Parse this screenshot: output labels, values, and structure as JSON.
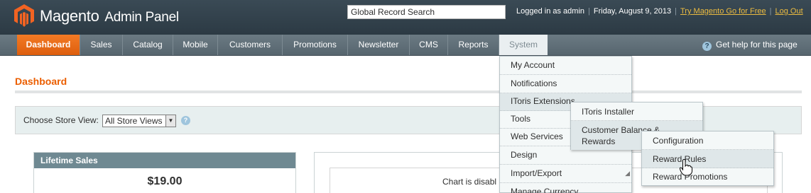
{
  "header": {
    "logo_name": "Magento",
    "logo_sub": "Admin Panel",
    "search_value": "Global Record Search",
    "logged_in": "Logged in as admin",
    "date": "Friday, August 9, 2013",
    "try_link": "Try Magento Go for Free",
    "logout": "Log Out"
  },
  "nav": {
    "items": [
      "Dashboard",
      "Sales",
      "Catalog",
      "Mobile",
      "Customers",
      "Promotions",
      "Newsletter",
      "CMS",
      "Reports",
      "System"
    ],
    "help": "Get help for this page"
  },
  "page": {
    "title": "Dashboard",
    "store_label": "Choose Store View:",
    "store_value": "All Store Views",
    "lifetime_title": "Lifetime Sales",
    "lifetime_value": "$19.00",
    "chart_text": "Chart is disabl"
  },
  "system_menu": [
    "My Account",
    "Notifications",
    "IToris Extensions",
    "Tools",
    "Web Services",
    "Design",
    "Import/Export",
    "Manage Currency"
  ],
  "itoris_menu": [
    "IToris Installer",
    "Customer Balance & Rewards"
  ],
  "rewards_menu": [
    "Configuration",
    "Reward Rules",
    "Reward Promotions"
  ],
  "colors": {
    "accent": "#eb5e00",
    "header_bg": "#2c3a44",
    "link": "#ebbb40"
  }
}
